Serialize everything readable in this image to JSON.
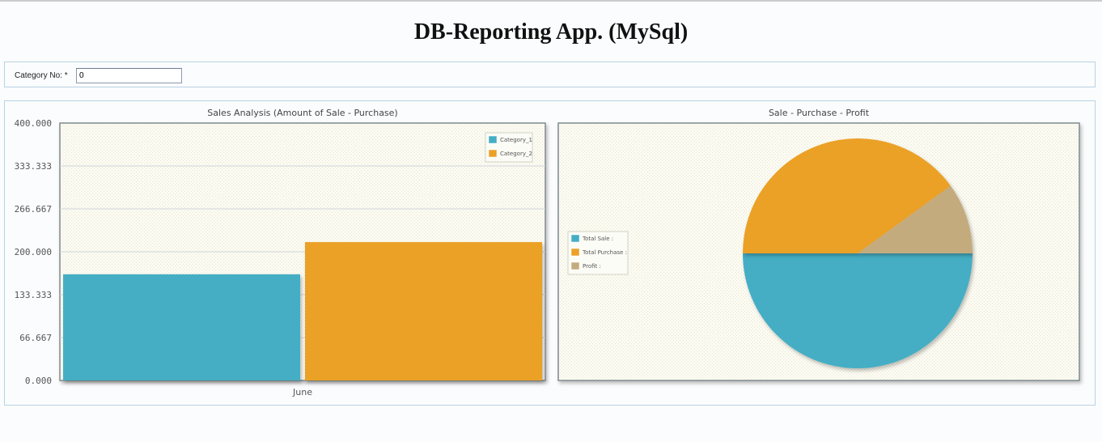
{
  "page": {
    "title": "DB-Reporting App. (MySql)"
  },
  "filter": {
    "label": "Category No: *",
    "value": "0"
  },
  "chart_data": [
    {
      "type": "bar",
      "title": "Sales Analysis (Amount of Sale - Purchase)",
      "categories": [
        "June"
      ],
      "series": [
        {
          "name": "Category_1",
          "values": [
            165
          ],
          "color": "#44aec4"
        },
        {
          "name": "Category_2",
          "values": [
            215
          ],
          "color": "#eba127"
        }
      ],
      "ylim": [
        0,
        400
      ],
      "yticks": [
        "0.000",
        "66.667",
        "133.333",
        "200.000",
        "266.667",
        "333.333",
        "400.000"
      ],
      "ytick_values": [
        0,
        66.667,
        133.333,
        200,
        266.667,
        333.333,
        400
      ],
      "grid": true,
      "legend_position": "top-right"
    },
    {
      "type": "pie",
      "title": "Sale - Purchase - Profit",
      "slices": [
        {
          "label": "Total Sale :",
          "value": 50,
          "color": "#44aec4"
        },
        {
          "label": "Total Purchase :",
          "value": 40,
          "color": "#eba127"
        },
        {
          "label": "Profit :",
          "value": 10,
          "color": "#c4ab7d"
        }
      ],
      "legend_position": "left"
    }
  ]
}
